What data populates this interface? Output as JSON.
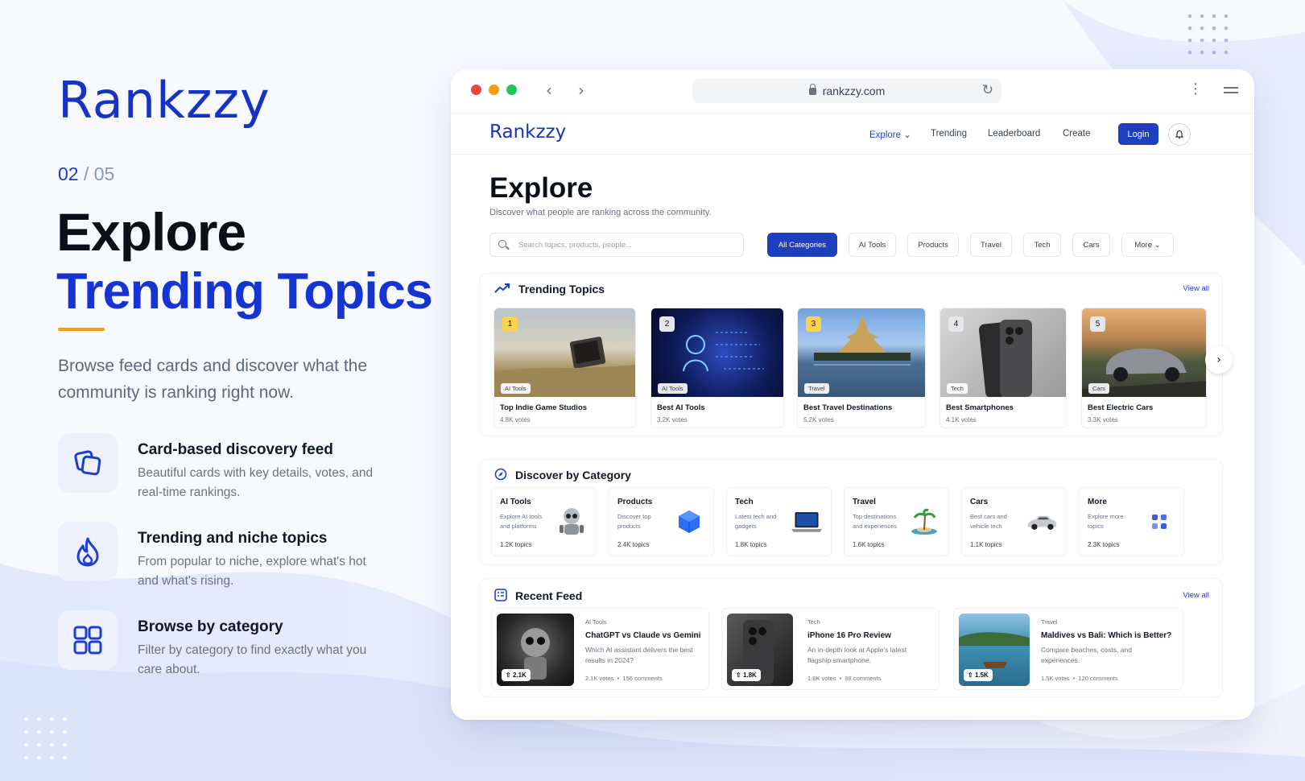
{
  "brand": {
    "name": "Rankzzy",
    "accent_color": "#f59e0b",
    "primary_color": "#1634c4"
  },
  "step": {
    "current": "02",
    "separator": "/",
    "total": "05"
  },
  "hero": {
    "line1": "Explore",
    "line2": "Trending Topics",
    "description": "Browse feed cards and discover what the community is ranking right now."
  },
  "features": [
    {
      "icon": "cards-icon",
      "title": "Card-based discovery feed",
      "desc": "Beautiful cards with key details, votes, and real-time rankings."
    },
    {
      "icon": "flame-icon",
      "title": "Trending and niche topics",
      "desc": "From popular to niche, explore what's hot and what's rising."
    },
    {
      "icon": "grid-icon",
      "title": "Browse by category",
      "desc": "Filter by category to find exactly what you care about."
    }
  ],
  "browser": {
    "url": "rankzzy.com"
  },
  "site": {
    "logo": "Rankzzy",
    "nav": [
      "Explore",
      "Trending",
      "Leaderboard",
      "Create"
    ],
    "login": "Login"
  },
  "explore": {
    "title": "Explore",
    "subtitle": "Discover what people are ranking across the community.",
    "search_placeholder": "Search topics, products, people...",
    "chips": [
      "All Categories",
      "AI Tools",
      "Products",
      "Travel",
      "Tech",
      "Cars",
      "More"
    ]
  },
  "trending": {
    "title": "Trending Topics",
    "view_all": "View all",
    "items": [
      {
        "rank": "1",
        "tag": "AI Tools",
        "name": "Top Indie Game Studios",
        "votes": "4.8K votes"
      },
      {
        "rank": "2",
        "tag": "AI Tools",
        "name": "Best AI Tools",
        "votes": "3.2K votes"
      },
      {
        "rank": "3",
        "tag": "Travel",
        "name": "Best Travel Destinations",
        "votes": "5.2K votes"
      },
      {
        "rank": "4",
        "tag": "Tech",
        "name": "Best Smartphones",
        "votes": "4.1K votes"
      },
      {
        "rank": "5",
        "tag": "Cars",
        "name": "Best Electric Cars",
        "votes": "3.3K votes"
      }
    ]
  },
  "categories": {
    "title": "Discover by Category",
    "items": [
      {
        "name": "AI Tools",
        "desc": "Explore AI tools and platforms",
        "count": "1.2K topics",
        "icon": "robot-icon"
      },
      {
        "name": "Products",
        "desc": "Discover top products",
        "count": "2.4K topics",
        "icon": "cube-icon"
      },
      {
        "name": "Tech",
        "desc": "Latest tech and gadgets",
        "count": "1.8K topics",
        "icon": "laptop-icon"
      },
      {
        "name": "Travel",
        "desc": "Top destinations and experiences",
        "count": "1.6K topics",
        "icon": "island-icon"
      },
      {
        "name": "Cars",
        "desc": "Best cars and vehicle tech",
        "count": "1.1K topics",
        "icon": "car-icon"
      },
      {
        "name": "More",
        "desc": "Explore more topics",
        "count": "2.3K topics",
        "icon": "grid-dots-icon"
      }
    ]
  },
  "feed": {
    "title": "Recent Feed",
    "view_all": "View all",
    "items": [
      {
        "category": "AI Tools",
        "title": "ChatGPT vs Claude vs Gemini",
        "desc": "Which AI assistant delivers the best results in 2024?",
        "upvotes": "2.1K",
        "votes": "2.1K votes",
        "comments": "156 comments"
      },
      {
        "category": "Tech",
        "title": "iPhone 16 Pro Review",
        "desc": "An in-depth look at Apple's latest flagship smartphone.",
        "upvotes": "1.8K",
        "votes": "1.8K votes",
        "comments": "98 comments"
      },
      {
        "category": "Travel",
        "title": "Maldives vs Bali: Which is Better?",
        "desc": "Compare beaches, costs, and experiences.",
        "upvotes": "1.5K",
        "votes": "1.5K votes",
        "comments": "120 comments"
      }
    ]
  }
}
